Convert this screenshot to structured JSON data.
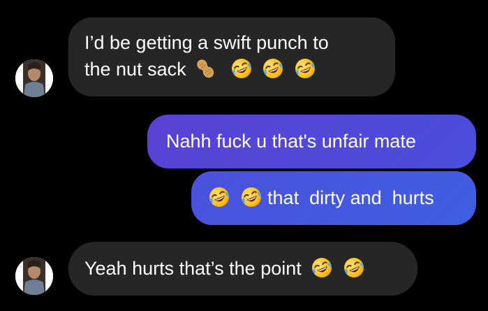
{
  "conversation": {
    "messages": [
      {
        "sender": "them",
        "text_line1": "I’d be getting a swift punch to",
        "text_line2": "the nut sack",
        "emojis": [
          "peanut-emoji",
          "rolling-laughing-emoji",
          "rolling-laughing-emoji",
          "rolling-laughing-emoji"
        ]
      },
      {
        "sender": "me",
        "text": "Nahh fuck u that's unfair mate"
      },
      {
        "sender": "me",
        "text": "that  dirty and  hurts",
        "emojis": [
          "rolling-laughing-emoji",
          "rolling-laughing-emoji"
        ]
      },
      {
        "sender": "them",
        "text": "Yeah hurts that’s the point",
        "emojis": [
          "rolling-laughing-emoji",
          "rolling-laughing-emoji"
        ]
      }
    ]
  },
  "colors": {
    "background": "#000000",
    "received_bubble": "#262626",
    "sent_bubble_top": "#5a43d6",
    "sent_bubble_bottom": "#3f5ce0",
    "text": "#ffffff"
  }
}
